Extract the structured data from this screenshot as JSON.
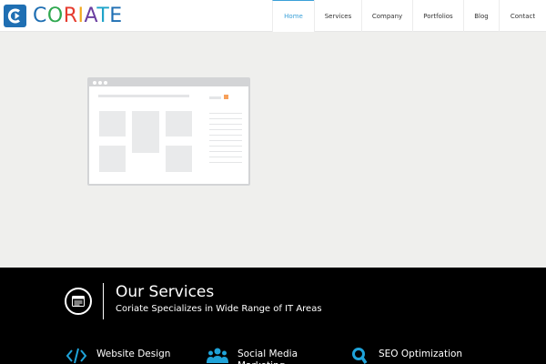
{
  "brand": {
    "name_letters": [
      "C",
      "O",
      "R",
      "I",
      "A",
      "T",
      "E"
    ]
  },
  "nav": {
    "items": [
      {
        "label": "Home",
        "active": true
      },
      {
        "label": "Services",
        "active": false
      },
      {
        "label": "Company",
        "active": false
      },
      {
        "label": "Portfolios",
        "active": false
      },
      {
        "label": "Blog",
        "active": false
      },
      {
        "label": "Contact",
        "active": false
      }
    ]
  },
  "services": {
    "title": "Our Services",
    "subtitle": "Coriate Specializes in Wide Range of IT Areas",
    "items": [
      {
        "label": "Website Design",
        "icon": "code-icon"
      },
      {
        "label": "Social Media Marketing",
        "icon": "users-icon"
      },
      {
        "label": "SEO Optimization",
        "icon": "magnifier-icon"
      }
    ]
  },
  "colors": {
    "accent": "#3aa0d8",
    "section_bg": "#000000",
    "hero_bg": "#efefed",
    "icon_blue": "#1fa3d9"
  }
}
